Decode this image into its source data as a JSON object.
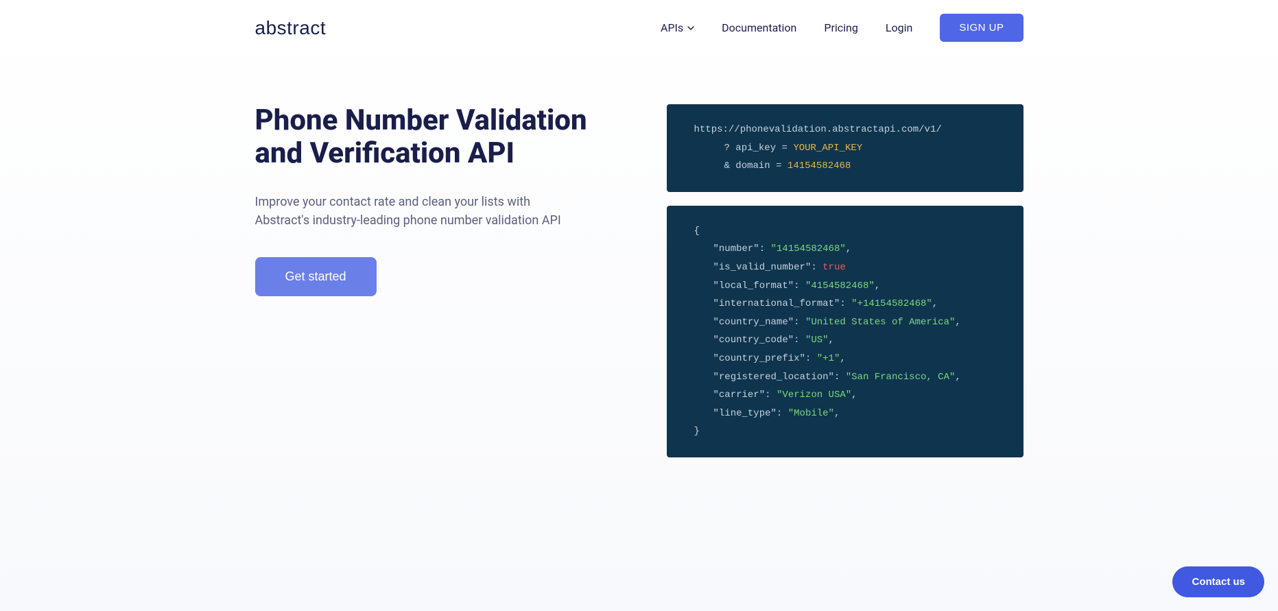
{
  "header": {
    "logo": "abstract",
    "nav": {
      "apis": "APIs",
      "documentation": "Documentation",
      "pricing": "Pricing",
      "login": "Login",
      "signup": "SIGN UP"
    }
  },
  "hero": {
    "title": "Phone Number Validation and Verification API",
    "subtitle": "Improve your contact rate and clean your lists with Abstract's industry-leading phone number validation API",
    "cta": "Get started"
  },
  "request": {
    "url": "https://phonevalidation.abstractapi.com/v1/",
    "param1_label": "? api_key = ",
    "param1_value": "YOUR_API_KEY",
    "param2_label": "& domain = ",
    "param2_value": "14154582468"
  },
  "response": {
    "open": "{",
    "close": "}",
    "fields": [
      {
        "key": "\"number\"",
        "colon": ": ",
        "value": "\"14154582468\"",
        "type": "string",
        "comma": ","
      },
      {
        "key": "\"is_valid_number\"",
        "colon": ": ",
        "value": "true",
        "type": "bool",
        "comma": ""
      },
      {
        "key": "\"local_format\"",
        "colon": ": ",
        "value": "\"4154582468\"",
        "type": "string",
        "comma": ","
      },
      {
        "key": "\"international_format\"",
        "colon": ": ",
        "value": "\"+14154582468\"",
        "type": "string",
        "comma": ","
      },
      {
        "key": "\"country_name\"",
        "colon": ": ",
        "value": "\"United States of America\"",
        "type": "string",
        "comma": ","
      },
      {
        "key": "\"country_code\"",
        "colon": ": ",
        "value": "\"US\"",
        "type": "string",
        "comma": ","
      },
      {
        "key": "\"country_prefix\"",
        "colon": ": ",
        "value": "\"+1\"",
        "type": "string",
        "comma": ","
      },
      {
        "key": "\"registered_location\"",
        "colon": ": ",
        "value": "\"San Francisco, CA\"",
        "type": "string",
        "comma": ","
      },
      {
        "key": "\"carrier\"",
        "colon": ": ",
        "value": "\"Verizon USA\"",
        "type": "string",
        "comma": ","
      },
      {
        "key": "\"line_type\"",
        "colon": ": ",
        "value": "\"Mobile\"",
        "type": "string",
        "comma": ","
      }
    ]
  },
  "contact": "Contact us"
}
